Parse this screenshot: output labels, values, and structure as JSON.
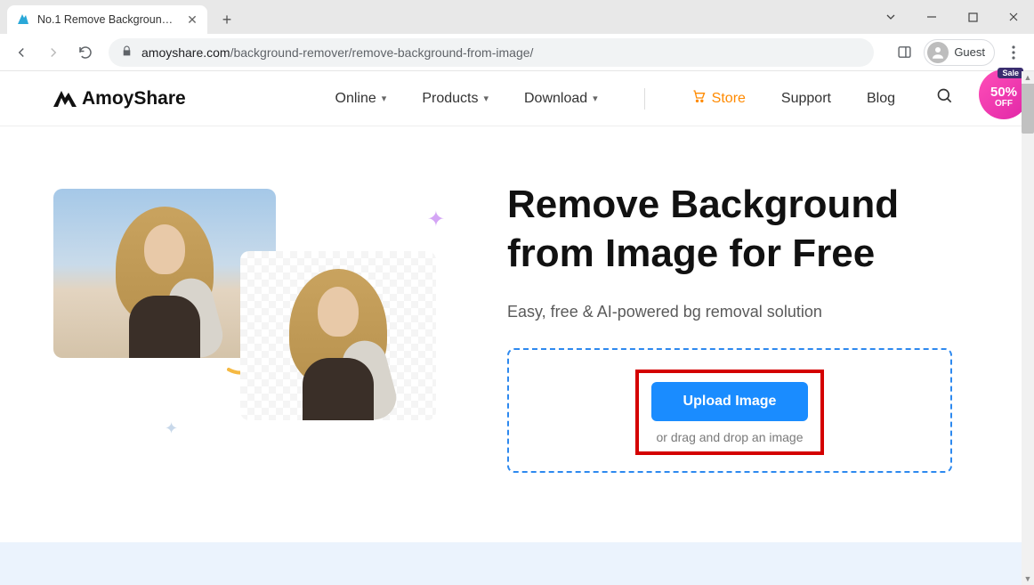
{
  "browser": {
    "tab_title": "No.1 Remove Background from",
    "url_domain": "amoyshare.com",
    "url_path": "/background-remover/remove-background-from-image/",
    "profile_label": "Guest"
  },
  "header": {
    "logo_text": "AmoyShare",
    "nav": {
      "online": "Online",
      "products": "Products",
      "download": "Download",
      "store": "Store",
      "support": "Support",
      "blog": "Blog"
    },
    "sale": {
      "tag": "Sale",
      "percent": "50%",
      "off": "OFF"
    }
  },
  "hero": {
    "title": "Remove Background from Image for Free",
    "subtitle": "Easy, free & AI-powered bg removal solution",
    "upload_button": "Upload Image",
    "drop_hint": "or drag and drop an image"
  }
}
